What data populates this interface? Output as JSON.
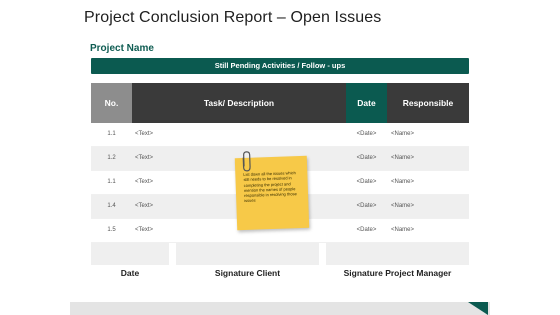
{
  "page": {
    "title": "Project Conclusion Report – Open Issues",
    "project_name": "Project Name",
    "pending_banner": "Still Pending Activities  / Follow - ups"
  },
  "table": {
    "headers": {
      "no": "No.",
      "task": "Task/ Description",
      "date": "Date",
      "responsible": "Responsible"
    },
    "rows": [
      {
        "no": "1.1",
        "task": "<Text>",
        "date": "<Date>",
        "name": "<Name>"
      },
      {
        "no": "1.2",
        "task": "<Text>",
        "date": "<Date>",
        "name": "<Name>"
      },
      {
        "no": "1.1",
        "task": "<Text>",
        "date": "<Date>",
        "name": "<Name>"
      },
      {
        "no": "1.4",
        "task": "<Text>",
        "date": "<Date>",
        "name": "<Name>"
      },
      {
        "no": "1.5",
        "task": "<Text>",
        "date": "<Date>",
        "name": "<Name>"
      }
    ]
  },
  "sticky_note": {
    "text": "List down all the issues which still needs to be resolved in completing the project and mention the names of people responsible in resolving those issues",
    "color": "#f7c948",
    "icon": "paperclip-icon"
  },
  "signatures": {
    "date": "Date",
    "client": "Signature Client",
    "manager": "Signature Project Manager"
  },
  "colors": {
    "accent": "#0b5a50",
    "header_dark": "#3a3a3a",
    "header_grey": "#8d8d8d",
    "row_alt": "#efefef"
  }
}
